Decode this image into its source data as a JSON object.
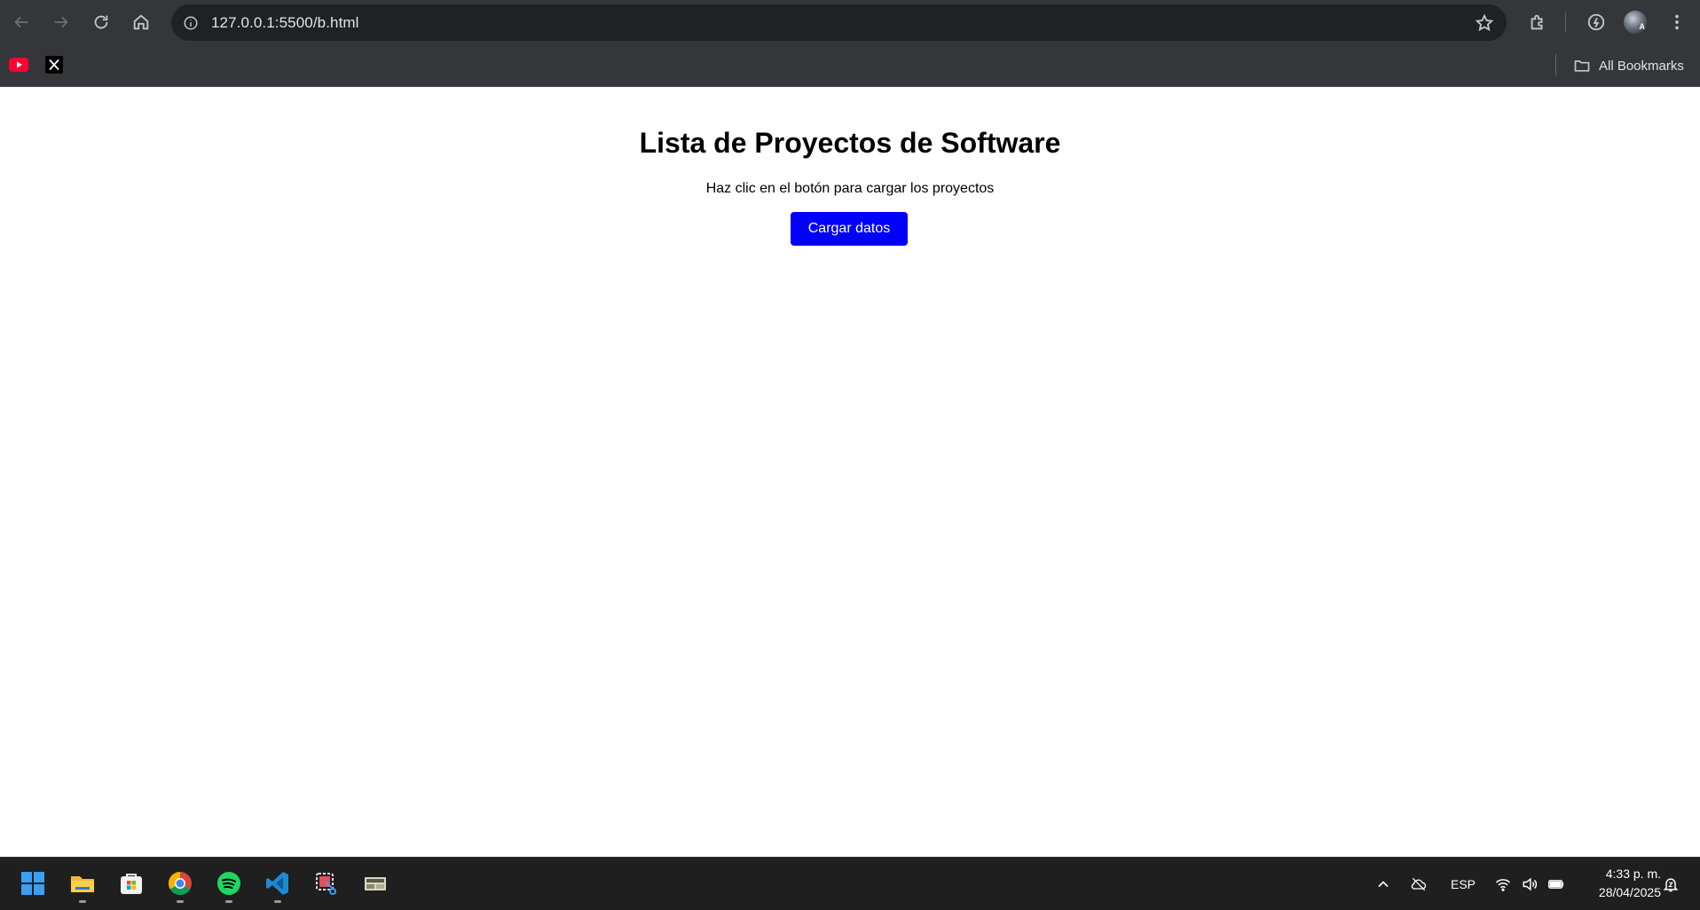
{
  "browser": {
    "url": "127.0.0.1:5500/b.html",
    "bookmarks_bar": {
      "items": [
        {
          "name": "youtube",
          "icon": "youtube-icon"
        },
        {
          "name": "x",
          "icon": "x-icon"
        }
      ],
      "all_bookmarks_label": "All Bookmarks"
    },
    "profile_initials": "A",
    "colors": {
      "toolbar": "#35363a",
      "omnibox": "#202124"
    }
  },
  "page": {
    "title": "Lista de Proyectos de Software",
    "subtitle": "Haz clic en el botón para cargar los proyectos",
    "load_button_label": "Cargar datos",
    "button_color": "#0000ff"
  },
  "taskbar": {
    "apps": [
      {
        "name": "start",
        "icon": "windows-start-icon"
      },
      {
        "name": "file-explorer",
        "icon": "folder-icon",
        "running": true
      },
      {
        "name": "microsoft-store",
        "icon": "store-icon",
        "running": false
      },
      {
        "name": "chrome",
        "icon": "chrome-icon",
        "running": true
      },
      {
        "name": "spotify",
        "icon": "spotify-icon",
        "running": true
      },
      {
        "name": "vscode",
        "icon": "vscode-icon",
        "running": true
      },
      {
        "name": "snipping-tool",
        "icon": "snipping-tool-icon",
        "running": false
      },
      {
        "name": "app",
        "icon": "app-icon",
        "running": false
      }
    ],
    "language": "ESP",
    "time": "4:33 p. m.",
    "date": "28/04/2025"
  }
}
